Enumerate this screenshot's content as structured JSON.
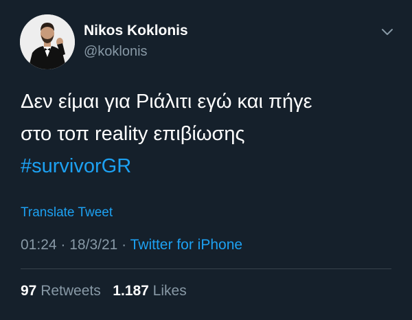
{
  "author": {
    "display_name": "Nikos Koklonis",
    "handle": "@koklonis"
  },
  "icons": {
    "avatar": "profile-photo",
    "menu": "chevron-down-icon"
  },
  "tweet": {
    "line1": "Δεν είμαι για Ριάλιτι εγώ και πήγε",
    "line2": "στο τοπ reality επιβίωσης",
    "hashtag": "#survivorGR",
    "translate_label": "Translate Tweet"
  },
  "meta": {
    "time": "01:24",
    "date": "18/3/21",
    "separator": "·",
    "source": "Twitter for iPhone"
  },
  "stats": {
    "retweets_count": "97",
    "retweets_label": "Retweets",
    "likes_count": "1.187",
    "likes_label": "Likes"
  },
  "colors": {
    "background": "#15202b",
    "accent": "#1da1f2",
    "secondary_text": "#8899a6",
    "divider": "#38444d"
  }
}
